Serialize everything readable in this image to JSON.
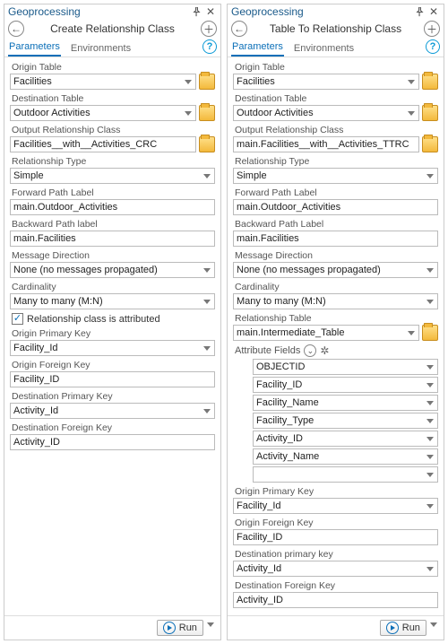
{
  "left": {
    "window_title": "Geoprocessing",
    "tool_title": "Create Relationship Class",
    "tabs": {
      "parameters": "Parameters",
      "environments": "Environments"
    },
    "fields": {
      "origin_table": {
        "label": "Origin Table",
        "value": "Facilities"
      },
      "destination_table": {
        "label": "Destination Table",
        "value": "Outdoor Activities"
      },
      "output_rc": {
        "label": "Output Relationship Class",
        "value": "Facilities__with__Activities_CRC"
      },
      "relationship_type": {
        "label": "Relationship Type",
        "value": "Simple"
      },
      "forward_path": {
        "label": "Forward Path Label",
        "value": "main.Outdoor_Activities"
      },
      "backward_path": {
        "label": "Backward Path label",
        "value": "main.Facilities"
      },
      "message_direction": {
        "label": "Message Direction",
        "value": "None (no messages propagated)"
      },
      "cardinality": {
        "label": "Cardinality",
        "value": "Many to many (M:N)"
      },
      "attributed": {
        "label": "Relationship class is attributed",
        "checked": true
      },
      "origin_pk": {
        "label": "Origin Primary Key",
        "value": "Facility_Id"
      },
      "origin_fk": {
        "label": "Origin Foreign Key",
        "value": "Facility_ID"
      },
      "dest_pk": {
        "label": "Destination Primary Key",
        "value": "Activity_Id"
      },
      "dest_fk": {
        "label": "Destination Foreign Key",
        "value": "Activity_ID"
      }
    },
    "run": "Run"
  },
  "right": {
    "window_title": "Geoprocessing",
    "tool_title": "Table To Relationship Class",
    "tabs": {
      "parameters": "Parameters",
      "environments": "Environments"
    },
    "fields": {
      "origin_table": {
        "label": "Origin Table",
        "value": "Facilities"
      },
      "destination_table": {
        "label": "Destination Table",
        "value": "Outdoor Activities"
      },
      "output_rc": {
        "label": "Output Relationship Class",
        "value": "main.Facilities__with__Activities_TTRC"
      },
      "relationship_type": {
        "label": "Relationship Type",
        "value": "Simple"
      },
      "forward_path": {
        "label": "Forward Path Label",
        "value": "main.Outdoor_Activities"
      },
      "backward_path": {
        "label": "Backward Path Label",
        "value": "main.Facilities"
      },
      "message_direction": {
        "label": "Message Direction",
        "value": "None (no messages propagated)"
      },
      "cardinality": {
        "label": "Cardinality",
        "value": "Many to many (M:N)"
      },
      "relationship_table": {
        "label": "Relationship Table",
        "value": "main.Intermediate_Table"
      },
      "attribute_fields": {
        "label": "Attribute Fields",
        "items": [
          "OBJECTID",
          "Facility_ID",
          "Facility_Name",
          "Facility_Type",
          "Activity_ID",
          "Activity_Name",
          ""
        ]
      },
      "origin_pk": {
        "label": "Origin Primary Key",
        "value": "Facility_Id"
      },
      "origin_fk": {
        "label": "Origin Foreign Key",
        "value": "Facility_ID"
      },
      "dest_pk": {
        "label": "Destination primary key",
        "value": "Activity_Id"
      },
      "dest_fk": {
        "label": "Destination Foreign Key",
        "value": "Activity_ID"
      }
    },
    "run": "Run"
  }
}
